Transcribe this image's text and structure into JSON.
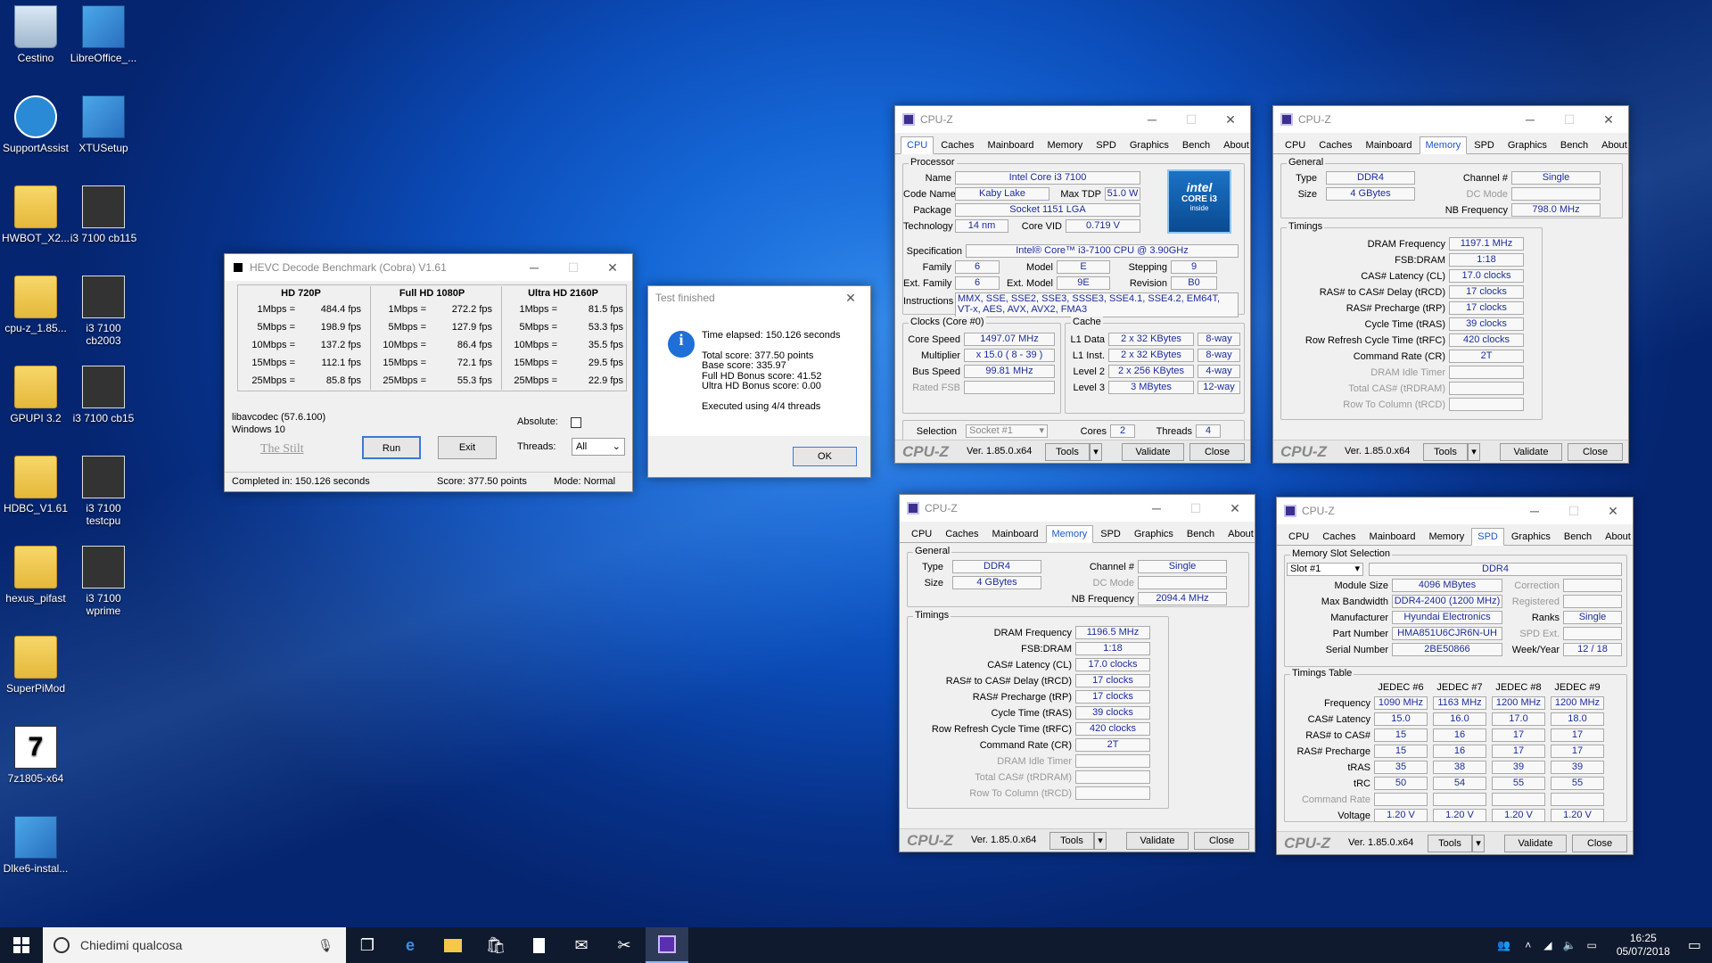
{
  "desktop": {
    "icons": [
      {
        "label": "Cestino",
        "kind": "bin"
      },
      {
        "label": "LibreOffice_...",
        "kind": "setup"
      },
      {
        "label": "SupportAssist",
        "kind": "app1"
      },
      {
        "label": "XTUSetup",
        "kind": "setup"
      },
      {
        "label": "HWBOT_X2...",
        "kind": "folder"
      },
      {
        "label": "i3 7100 cb115",
        "kind": "shot"
      },
      {
        "label": "cpu-z_1.85...",
        "kind": "folder"
      },
      {
        "label": "i3 7100 cb2003",
        "kind": "shot"
      },
      {
        "label": "GPUPI 3.2",
        "kind": "folder"
      },
      {
        "label": "i3 7100 cb15",
        "kind": "shot"
      },
      {
        "label": "HDBC_V1.61",
        "kind": "folder"
      },
      {
        "label": "i3 7100 testcpu",
        "kind": "shot"
      },
      {
        "label": "hexus_pifast",
        "kind": "folder"
      },
      {
        "label": "i3 7100 wprime",
        "kind": "shot"
      },
      {
        "label": "SuperPiMod",
        "kind": "folder"
      },
      {
        "label": "7z1805-x64",
        "kind": "seven"
      },
      {
        "label": "Dlke6-instal...",
        "kind": "setup"
      }
    ]
  },
  "hevc": {
    "title": "HEVC Decode Benchmark (Cobra) V1.61",
    "cols": [
      {
        "header": "HD 720P",
        "rows": [
          [
            "1Mbps =",
            "484.4 fps"
          ],
          [
            "5Mbps =",
            "198.9 fps"
          ],
          [
            "10Mbps =",
            "137.2 fps"
          ],
          [
            "15Mbps =",
            "112.1 fps"
          ],
          [
            "25Mbps =",
            "85.8 fps"
          ]
        ]
      },
      {
        "header": "Full HD 1080P",
        "rows": [
          [
            "1Mbps =",
            "272.2 fps"
          ],
          [
            "5Mbps =",
            "127.9 fps"
          ],
          [
            "10Mbps =",
            "86.4 fps"
          ],
          [
            "15Mbps =",
            "72.1 fps"
          ],
          [
            "25Mbps =",
            "55.3 fps"
          ]
        ]
      },
      {
        "header": "Ultra HD 2160P",
        "rows": [
          [
            "1Mbps =",
            "81.5 fps"
          ],
          [
            "5Mbps =",
            "53.3 fps"
          ],
          [
            "10Mbps =",
            "35.5 fps"
          ],
          [
            "15Mbps =",
            "29.5 fps"
          ],
          [
            "25Mbps =",
            "22.9 fps"
          ]
        ]
      }
    ],
    "lib": "libavcodec (57.6.100)",
    "os": "Windows 10",
    "author": "The Stilt",
    "run": "Run",
    "exit": "Exit",
    "absolute": "Absolute:",
    "threads_label": "Threads:",
    "threads_value": "All",
    "status_completed": "Completed in: 150.126 seconds",
    "status_score": "Score: 377.50 points",
    "status_mode": "Mode: Normal"
  },
  "dialog": {
    "title": "Test finished",
    "lines": [
      "Time elapsed:  150.126 seconds",
      "",
      "Total score:  377.50 points",
      "Base score: 335.97",
      "Full HD Bonus score: 41.52",
      "Ultra HD Bonus score: 0.00",
      "",
      "Executed using 4/4 threads"
    ],
    "ok": "OK"
  },
  "cpuz_common": {
    "title": "CPU-Z",
    "tabs": [
      "CPU",
      "Caches",
      "Mainboard",
      "Memory",
      "SPD",
      "Graphics",
      "Bench",
      "About"
    ],
    "logo": "CPU-Z",
    "version": "Ver. 1.85.0.x64",
    "tools": "Tools",
    "validate": "Validate",
    "close": "Close"
  },
  "cpu": {
    "processor": "Processor",
    "name_l": "Name",
    "name": "Intel Core i3 7100",
    "codename_l": "Code Name",
    "codename": "Kaby Lake",
    "maxtdp_l": "Max TDP",
    "maxtdp": "51.0 W",
    "package_l": "Package",
    "package": "Socket 1151 LGA",
    "tech_l": "Technology",
    "tech": "14 nm",
    "corevid_l": "Core VID",
    "corevid": "0.719 V",
    "spec_l": "Specification",
    "spec": "Intel® Core™ i3-7100 CPU @ 3.90GHz",
    "family_l": "Family",
    "family": "6",
    "model_l": "Model",
    "model": "E",
    "stepping_l": "Stepping",
    "stepping": "9",
    "extfam_l": "Ext. Family",
    "extfam": "6",
    "extmodel_l": "Ext. Model",
    "extmodel": "9E",
    "revision_l": "Revision",
    "revision": "B0",
    "instr_l": "Instructions",
    "instr": "MMX, SSE, SSE2, SSE3, SSSE3, SSE4.1, SSE4.2, EM64T, VT-x, AES, AVX, AVX2, FMA3",
    "clocks": "Clocks (Core #0)",
    "corespeed_l": "Core Speed",
    "corespeed": "1497.07 MHz",
    "mult_l": "Multiplier",
    "mult": "x 15.0 ( 8 - 39 )",
    "bus_l": "Bus Speed",
    "bus": "99.81 MHz",
    "ratedfsb": "Rated FSB",
    "cache": "Cache",
    "l1d_l": "L1 Data",
    "l1d": "2 x 32 KBytes",
    "l1d_w": "8-way",
    "l1i_l": "L1 Inst.",
    "l1i": "2 x 32 KBytes",
    "l1i_w": "8-way",
    "l2_l": "Level 2",
    "l2": "2 x 256 KBytes",
    "l2_w": "4-way",
    "l3_l": "Level 3",
    "l3": "3 MBytes",
    "l3_w": "12-way",
    "selection_l": "Selection",
    "selection": "Socket #1",
    "cores_l": "Cores",
    "cores": "2",
    "threads_l": "Threads",
    "threads": "4",
    "badge_brand": "intel",
    "badge_line": "CORE i3",
    "badge_inside": "inside"
  },
  "mem1": {
    "general": "General",
    "type_l": "Type",
    "type": "DDR4",
    "size_l": "Size",
    "size": "4 GBytes",
    "channel_l": "Channel #",
    "channel": "Single",
    "dcmode": "DC Mode",
    "nbf_l": "NB Frequency",
    "nbf": "798.0 MHz",
    "timings": "Timings",
    "rows": [
      [
        "DRAM Frequency",
        "1197.1 MHz"
      ],
      [
        "FSB:DRAM",
        "1:18"
      ],
      [
        "CAS# Latency (CL)",
        "17.0 clocks"
      ],
      [
        "RAS# to CAS# Delay (tRCD)",
        "17 clocks"
      ],
      [
        "RAS# Precharge (tRP)",
        "17 clocks"
      ],
      [
        "Cycle Time (tRAS)",
        "39 clocks"
      ],
      [
        "Row Refresh Cycle Time (tRFC)",
        "420 clocks"
      ],
      [
        "Command Rate (CR)",
        "2T"
      ]
    ],
    "dim_rows": [
      "DRAM Idle Timer",
      "Total CAS# (tRDRAM)",
      "Row To Column (tRCD)"
    ]
  },
  "mem2": {
    "general": "General",
    "type_l": "Type",
    "type": "DDR4",
    "size_l": "Size",
    "size": "4 GBytes",
    "channel_l": "Channel #",
    "channel": "Single",
    "dcmode": "DC Mode",
    "nbf_l": "NB Frequency",
    "nbf": "2094.4 MHz",
    "timings": "Timings",
    "rows": [
      [
        "DRAM Frequency",
        "1196.5 MHz"
      ],
      [
        "FSB:DRAM",
        "1:18"
      ],
      [
        "CAS# Latency (CL)",
        "17.0 clocks"
      ],
      [
        "RAS# to CAS# Delay (tRCD)",
        "17 clocks"
      ],
      [
        "RAS# Precharge (tRP)",
        "17 clocks"
      ],
      [
        "Cycle Time (tRAS)",
        "39 clocks"
      ],
      [
        "Row Refresh Cycle Time (tRFC)",
        "420 clocks"
      ],
      [
        "Command Rate (CR)",
        "2T"
      ]
    ],
    "dim_rows": [
      "DRAM Idle Timer",
      "Total CAS# (tRDRAM)",
      "Row To Column (tRCD)"
    ]
  },
  "spd": {
    "slotsel": "Memory Slot Selection",
    "slot": "Slot #1",
    "memtype": "DDR4",
    "modsize_l": "Module Size",
    "modsize": "4096 MBytes",
    "correction": "Correction",
    "maxbw_l": "Max Bandwidth",
    "maxbw": "DDR4-2400 (1200 MHz)",
    "registered": "Registered",
    "manuf_l": "Manufacturer",
    "manuf": "Hyundai Electronics",
    "ranks_l": "Ranks",
    "ranks": "Single",
    "part_l": "Part Number",
    "part": "HMA851U6CJR6N-UH",
    "spdext": "SPD Ext.",
    "serial_l": "Serial Number",
    "serial": "2BE50866",
    "week_l": "Week/Year",
    "week": "12 / 18",
    "ttable": "Timings Table",
    "jedec": [
      "JEDEC #6",
      "JEDEC #7",
      "JEDEC #8",
      "JEDEC #9"
    ],
    "trows": [
      [
        "Frequency",
        [
          "1090 MHz",
          "1163 MHz",
          "1200 MHz",
          "1200 MHz"
        ]
      ],
      [
        "CAS# Latency",
        [
          "15.0",
          "16.0",
          "17.0",
          "18.0"
        ]
      ],
      [
        "RAS# to CAS#",
        [
          "15",
          "16",
          "17",
          "17"
        ]
      ],
      [
        "RAS# Precharge",
        [
          "15",
          "16",
          "17",
          "17"
        ]
      ],
      [
        "tRAS",
        [
          "35",
          "38",
          "39",
          "39"
        ]
      ],
      [
        "tRC",
        [
          "50",
          "54",
          "55",
          "55"
        ]
      ],
      [
        "Command Rate",
        [
          "",
          "",
          "",
          ""
        ]
      ],
      [
        "Voltage",
        [
          "1.20 V",
          "1.20 V",
          "1.20 V",
          "1.20 V"
        ]
      ]
    ]
  },
  "taskbar": {
    "search_placeholder": "Chiedimi qualcosa",
    "time": "16:25",
    "date": "05/07/2018"
  }
}
